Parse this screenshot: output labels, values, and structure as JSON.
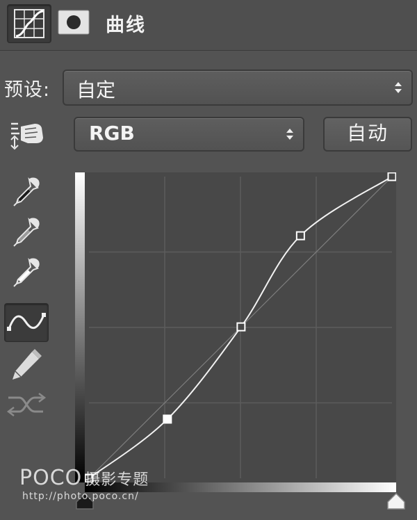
{
  "panel": {
    "title": "曲线",
    "tools": [
      {
        "name": "curves-adjustment-icon",
        "active": true
      },
      {
        "name": "layer-mask-icon",
        "active": false
      }
    ]
  },
  "preset": {
    "label": "预设:",
    "selected": "自定"
  },
  "channel": {
    "selected": "RGB",
    "auto_label": "自动"
  },
  "side_tools": [
    {
      "name": "targeted-adjustment-hand-icon"
    },
    {
      "name": "black-point-eyedropper-icon"
    },
    {
      "name": "gray-point-eyedropper-icon"
    },
    {
      "name": "white-point-eyedropper-icon"
    },
    {
      "name": "edit-curve-points-icon",
      "active": true
    },
    {
      "name": "draw-pencil-icon"
    },
    {
      "name": "smooth-curve-icon"
    }
  ],
  "curve": {
    "input_range": [
      0,
      255
    ],
    "output_range": [
      0,
      255
    ],
    "grid_divisions": 4,
    "points": [
      {
        "in": 0,
        "out": 0,
        "selected": false
      },
      {
        "in": 66,
        "out": 50,
        "selected": true
      },
      {
        "in": 128,
        "out": 128,
        "selected": false
      },
      {
        "in": 178,
        "out": 205,
        "selected": false
      },
      {
        "in": 255,
        "out": 255,
        "selected": false
      }
    ],
    "colors": {
      "curve": "#f2f2f2",
      "diagonal": "#7e7e7e",
      "grid": "#5c5c5c",
      "background": "#484848"
    }
  },
  "watermark": {
    "logo": "POCO",
    "subtitle": "摄影专题",
    "url": "http://photo.poco.cn/"
  }
}
